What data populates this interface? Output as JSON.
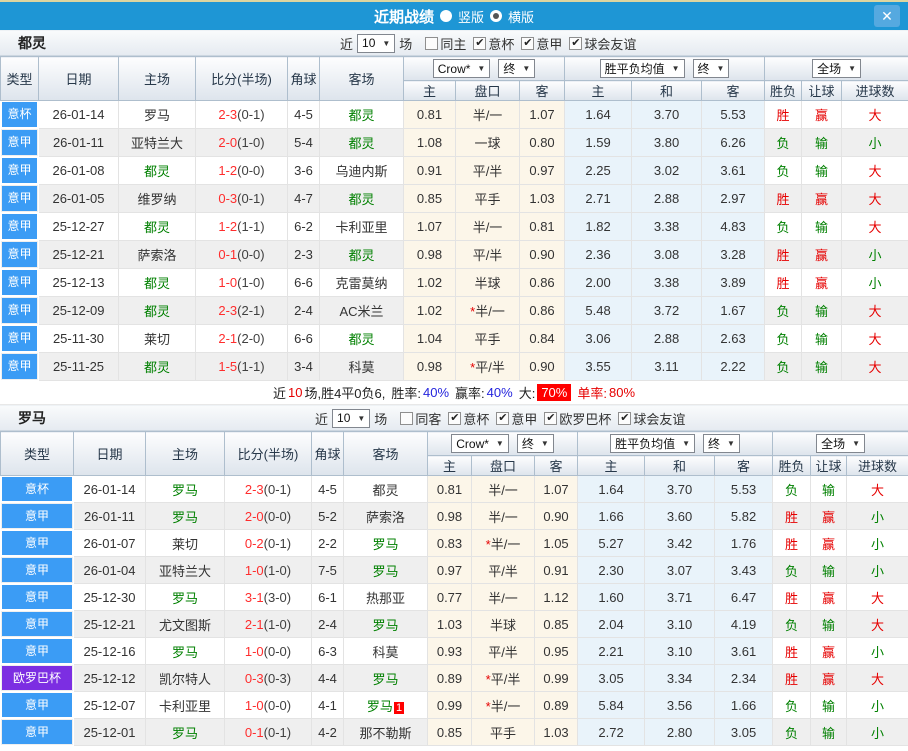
{
  "icons": {
    "dropdown_arrow": "▼",
    "check": "✔",
    "close": "✕"
  },
  "colors": {
    "accent_blue": "#1e96d5",
    "chip_blue": "#3b9cf5",
    "chip_purple": "#7c2ee2",
    "focal_green": "#008000",
    "result_red": "#e60000",
    "score_red": "#ff2d2d"
  },
  "semantics": {
    "result_colors": {
      "胜": "red",
      "负": "green",
      "赢": "red",
      "输": "green",
      "大": "red",
      "小": "green"
    }
  },
  "titlebar": {
    "title": "近期战绩",
    "radios": [
      {
        "label": "竖版",
        "selected": false
      },
      {
        "label": "横版",
        "selected": true
      }
    ]
  },
  "table": {
    "main_headers": [
      "类型",
      "日期",
      "主场",
      "比分(半场)",
      "角球",
      "客场"
    ],
    "sub_headers": [
      "主",
      "盘口",
      "客",
      "主",
      "和",
      "客",
      "胜负",
      "让球",
      "进球数"
    ]
  },
  "sections": [
    {
      "team": "都灵",
      "filter": {
        "near": "近",
        "count": "10",
        "games": "场",
        "checkboxes": [
          {
            "label": "同主",
            "checked": false
          },
          {
            "label": "意杯",
            "checked": true
          },
          {
            "label": "意甲",
            "checked": true
          },
          {
            "label": "球会友谊",
            "checked": true
          }
        ]
      },
      "dropdowns": [
        "Crow*",
        "终",
        "胜平负均值",
        "终",
        "全场"
      ],
      "rows": [
        {
          "league": "意杯",
          "league_style": "blue",
          "date": "26-01-14",
          "home": "罗马",
          "home_focal": false,
          "score": "2-3",
          "half": "(0-1)",
          "corner": "4-5",
          "away": "都灵",
          "away_focal": true,
          "away_badge": "",
          "w1": "0.81",
          "handicap": "半/一",
          "handicap_star": false,
          "w2": "1.07",
          "avg": [
            "1.64",
            "3.70",
            "5.53"
          ],
          "results": [
            "胜",
            "赢",
            "大"
          ]
        },
        {
          "league": "意甲",
          "league_style": "blue",
          "date": "26-01-11",
          "home": "亚特兰大",
          "home_focal": false,
          "score": "2-0",
          "half": "(1-0)",
          "corner": "5-4",
          "away": "都灵",
          "away_focal": true,
          "away_badge": "",
          "w1": "1.08",
          "handicap": "一球",
          "handicap_star": false,
          "w2": "0.80",
          "avg": [
            "1.59",
            "3.80",
            "6.26"
          ],
          "results": [
            "负",
            "输",
            "小"
          ]
        },
        {
          "league": "意甲",
          "league_style": "blue",
          "date": "26-01-08",
          "home": "都灵",
          "home_focal": true,
          "score": "1-2",
          "half": "(0-0)",
          "corner": "3-6",
          "away": "乌迪内斯",
          "away_focal": false,
          "away_badge": "",
          "w1": "0.91",
          "handicap": "平/半",
          "handicap_star": false,
          "w2": "0.97",
          "avg": [
            "2.25",
            "3.02",
            "3.61"
          ],
          "results": [
            "负",
            "输",
            "大"
          ]
        },
        {
          "league": "意甲",
          "league_style": "blue",
          "date": "26-01-05",
          "home": "维罗纳",
          "home_focal": false,
          "score": "0-3",
          "half": "(0-1)",
          "corner": "4-7",
          "away": "都灵",
          "away_focal": true,
          "away_badge": "",
          "w1": "0.85",
          "handicap": "平手",
          "handicap_star": false,
          "w2": "1.03",
          "avg": [
            "2.71",
            "2.88",
            "2.97"
          ],
          "results": [
            "胜",
            "赢",
            "大"
          ]
        },
        {
          "league": "意甲",
          "league_style": "blue",
          "date": "25-12-27",
          "home": "都灵",
          "home_focal": true,
          "score": "1-2",
          "half": "(1-1)",
          "corner": "6-2",
          "away": "卡利亚里",
          "away_focal": false,
          "away_badge": "",
          "w1": "1.07",
          "handicap": "半/一",
          "handicap_star": false,
          "w2": "0.81",
          "avg": [
            "1.82",
            "3.38",
            "4.83"
          ],
          "results": [
            "负",
            "输",
            "大"
          ]
        },
        {
          "league": "意甲",
          "league_style": "blue",
          "date": "25-12-21",
          "home": "萨索洛",
          "home_focal": false,
          "score": "0-1",
          "half": "(0-0)",
          "corner": "2-3",
          "away": "都灵",
          "away_focal": true,
          "away_badge": "",
          "w1": "0.98",
          "handicap": "平/半",
          "handicap_star": false,
          "w2": "0.90",
          "avg": [
            "2.36",
            "3.08",
            "3.28"
          ],
          "results": [
            "胜",
            "赢",
            "小"
          ]
        },
        {
          "league": "意甲",
          "league_style": "blue",
          "date": "25-12-13",
          "home": "都灵",
          "home_focal": true,
          "score": "1-0",
          "half": "(1-0)",
          "corner": "6-6",
          "away": "克雷莫纳",
          "away_focal": false,
          "away_badge": "",
          "w1": "1.02",
          "handicap": "半球",
          "handicap_star": false,
          "w2": "0.86",
          "avg": [
            "2.00",
            "3.38",
            "3.89"
          ],
          "results": [
            "胜",
            "赢",
            "小"
          ]
        },
        {
          "league": "意甲",
          "league_style": "blue",
          "date": "25-12-09",
          "home": "都灵",
          "home_focal": true,
          "score": "2-3",
          "half": "(2-1)",
          "corner": "2-4",
          "away": "AC米兰",
          "away_focal": false,
          "away_badge": "",
          "w1": "1.02",
          "handicap": "半/一",
          "handicap_star": true,
          "w2": "0.86",
          "avg": [
            "5.48",
            "3.72",
            "1.67"
          ],
          "results": [
            "负",
            "输",
            "大"
          ]
        },
        {
          "league": "意甲",
          "league_style": "blue",
          "date": "25-11-30",
          "home": "莱切",
          "home_focal": false,
          "score": "2-1",
          "half": "(2-0)",
          "corner": "6-6",
          "away": "都灵",
          "away_focal": true,
          "away_badge": "",
          "w1": "1.04",
          "handicap": "平手",
          "handicap_star": false,
          "w2": "0.84",
          "avg": [
            "3.06",
            "2.88",
            "2.63"
          ],
          "results": [
            "负",
            "输",
            "大"
          ]
        },
        {
          "league": "意甲",
          "league_style": "blue",
          "date": "25-11-25",
          "home": "都灵",
          "home_focal": true,
          "score": "1-5",
          "half": "(1-1)",
          "corner": "3-4",
          "away": "科莫",
          "away_focal": false,
          "away_badge": "",
          "w1": "0.98",
          "handicap": "平/半",
          "handicap_star": true,
          "w2": "0.90",
          "avg": [
            "3.55",
            "3.11",
            "2.22"
          ],
          "results": [
            "负",
            "输",
            "大"
          ]
        }
      ],
      "summary": {
        "prefix": "近",
        "count": "10",
        "record": "场,胜4平0负6,",
        "win_label": "胜率:",
        "win": "40%",
        "asia_label": "赢率:",
        "asia": "40%",
        "big_label": "大:",
        "big": "70%",
        "single_label": "单率:",
        "single": "80%"
      }
    },
    {
      "team": "罗马",
      "filter": {
        "near": "近",
        "count": "10",
        "games": "场",
        "checkboxes": [
          {
            "label": "同客",
            "checked": false
          },
          {
            "label": "意杯",
            "checked": true
          },
          {
            "label": "意甲",
            "checked": true
          },
          {
            "label": "欧罗巴杯",
            "checked": true
          },
          {
            "label": "球会友谊",
            "checked": true
          }
        ]
      },
      "dropdowns": [
        "Crow*",
        "终",
        "胜平负均值",
        "终",
        "全场"
      ],
      "rows": [
        {
          "league": "意杯",
          "league_style": "blue",
          "date": "26-01-14",
          "home": "罗马",
          "home_focal": true,
          "score": "2-3",
          "half": "(0-1)",
          "corner": "4-5",
          "away": "都灵",
          "away_focal": false,
          "away_badge": "",
          "w1": "0.81",
          "handicap": "半/一",
          "handicap_star": false,
          "w2": "1.07",
          "avg": [
            "1.64",
            "3.70",
            "5.53"
          ],
          "results": [
            "负",
            "输",
            "大"
          ]
        },
        {
          "league": "意甲",
          "league_style": "blue",
          "date": "26-01-11",
          "home": "罗马",
          "home_focal": true,
          "score": "2-0",
          "half": "(0-0)",
          "corner": "5-2",
          "away": "萨索洛",
          "away_focal": false,
          "away_badge": "",
          "w1": "0.98",
          "handicap": "半/一",
          "handicap_star": false,
          "w2": "0.90",
          "avg": [
            "1.66",
            "3.60",
            "5.82"
          ],
          "results": [
            "胜",
            "赢",
            "小"
          ]
        },
        {
          "league": "意甲",
          "league_style": "blue",
          "date": "26-01-07",
          "home": "莱切",
          "home_focal": false,
          "score": "0-2",
          "half": "(0-1)",
          "corner": "2-2",
          "away": "罗马",
          "away_focal": true,
          "away_badge": "",
          "w1": "0.83",
          "handicap": "半/一",
          "handicap_star": true,
          "w2": "1.05",
          "avg": [
            "5.27",
            "3.42",
            "1.76"
          ],
          "results": [
            "胜",
            "赢",
            "小"
          ]
        },
        {
          "league": "意甲",
          "league_style": "blue",
          "date": "26-01-04",
          "home": "亚特兰大",
          "home_focal": false,
          "score": "1-0",
          "half": "(1-0)",
          "corner": "7-5",
          "away": "罗马",
          "away_focal": true,
          "away_badge": "",
          "w1": "0.97",
          "handicap": "平/半",
          "handicap_star": false,
          "w2": "0.91",
          "avg": [
            "2.30",
            "3.07",
            "3.43"
          ],
          "results": [
            "负",
            "输",
            "小"
          ]
        },
        {
          "league": "意甲",
          "league_style": "blue",
          "date": "25-12-30",
          "home": "罗马",
          "home_focal": true,
          "score": "3-1",
          "half": "(3-0)",
          "corner": "6-1",
          "away": "热那亚",
          "away_focal": false,
          "away_badge": "",
          "w1": "0.77",
          "handicap": "半/一",
          "handicap_star": false,
          "w2": "1.12",
          "avg": [
            "1.60",
            "3.71",
            "6.47"
          ],
          "results": [
            "胜",
            "赢",
            "大"
          ]
        },
        {
          "league": "意甲",
          "league_style": "blue",
          "date": "25-12-21",
          "home": "尤文图斯",
          "home_focal": false,
          "score": "2-1",
          "half": "(1-0)",
          "corner": "2-4",
          "away": "罗马",
          "away_focal": true,
          "away_badge": "",
          "w1": "1.03",
          "handicap": "半球",
          "handicap_star": false,
          "w2": "0.85",
          "avg": [
            "2.04",
            "3.10",
            "4.19"
          ],
          "results": [
            "负",
            "输",
            "大"
          ]
        },
        {
          "league": "意甲",
          "league_style": "blue",
          "date": "25-12-16",
          "home": "罗马",
          "home_focal": true,
          "score": "1-0",
          "half": "(0-0)",
          "corner": "6-3",
          "away": "科莫",
          "away_focal": false,
          "away_badge": "",
          "w1": "0.93",
          "handicap": "平/半",
          "handicap_star": false,
          "w2": "0.95",
          "avg": [
            "2.21",
            "3.10",
            "3.61"
          ],
          "results": [
            "胜",
            "赢",
            "小"
          ]
        },
        {
          "league": "欧罗巴杯",
          "league_style": "purple",
          "date": "25-12-12",
          "home": "凯尔特人",
          "home_focal": false,
          "score": "0-3",
          "half": "(0-3)",
          "corner": "4-4",
          "away": "罗马",
          "away_focal": true,
          "away_badge": "",
          "w1": "0.89",
          "handicap": "平/半",
          "handicap_star": true,
          "w2": "0.99",
          "avg": [
            "3.05",
            "3.34",
            "2.34"
          ],
          "results": [
            "胜",
            "赢",
            "大"
          ]
        },
        {
          "league": "意甲",
          "league_style": "blue",
          "date": "25-12-07",
          "home": "卡利亚里",
          "home_focal": false,
          "score": "1-0",
          "half": "(0-0)",
          "corner": "4-1",
          "away": "罗马",
          "away_focal": true,
          "away_badge": "1",
          "w1": "0.99",
          "handicap": "半/一",
          "handicap_star": true,
          "w2": "0.89",
          "avg": [
            "5.84",
            "3.56",
            "1.66"
          ],
          "results": [
            "负",
            "输",
            "小"
          ]
        },
        {
          "league": "意甲",
          "league_style": "blue",
          "date": "25-12-01",
          "home": "罗马",
          "home_focal": true,
          "score": "0-1",
          "half": "(0-1)",
          "corner": "4-2",
          "away": "那不勒斯",
          "away_focal": false,
          "away_badge": "",
          "w1": "0.85",
          "handicap": "平手",
          "handicap_star": false,
          "w2": "1.03",
          "avg": [
            "2.72",
            "2.80",
            "3.05"
          ],
          "results": [
            "负",
            "输",
            "小"
          ]
        }
      ]
    }
  ]
}
